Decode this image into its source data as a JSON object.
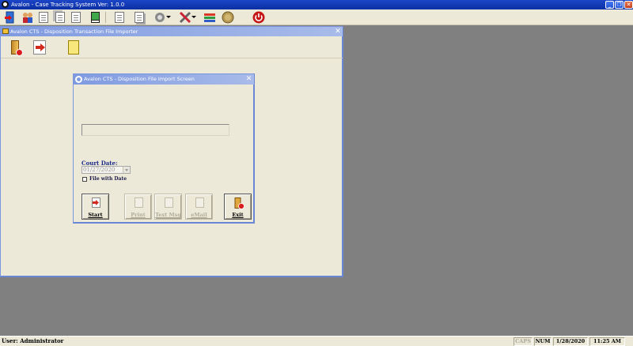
{
  "app": {
    "title": "Avalon - Case Tracking System   Ver: 1.0.0",
    "toolbar_icons": [
      "exit-door-icon",
      "users-icon",
      "document-icon",
      "documents-icon",
      "notes-icon",
      "green-book-icon",
      "list-icon",
      "copy-icon",
      "settings-gear-icon",
      "tools-icon",
      "chart-icon",
      "coin-icon",
      "power-icon"
    ]
  },
  "importer_window": {
    "title": "Avalon CTS - Disposition Transaction File Importer",
    "toolbar_icons": [
      "exit-door-icon",
      "import-arrow-icon",
      "yellow-documents-icon"
    ]
  },
  "dialog": {
    "title": "Avalon CTS - Disposition File Import Screen",
    "file_path": "",
    "court_date_label": "Court Date:",
    "court_date_value": "01/27/2020",
    "file_with_date_label": "File with Date",
    "file_with_date_checked": false,
    "buttons": {
      "start": "Start",
      "print": "Print",
      "text_msg": "Text Msg",
      "email": "eMail",
      "exit": "Exit"
    }
  },
  "status_bar": {
    "user": "User: Administrator",
    "caps": "CAPS",
    "num": "NUM",
    "date": "1/28/2020",
    "time": "11:25 AM"
  }
}
